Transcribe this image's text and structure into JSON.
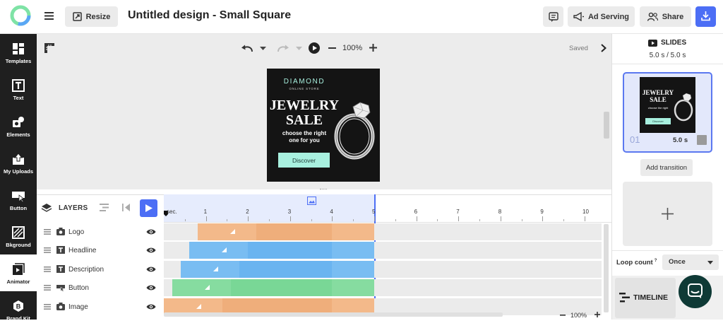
{
  "header": {
    "title": "Untitled design - Small Square",
    "resize_label": "Resize",
    "ad_serving_label": "Ad Serving",
    "share_label": "Share"
  },
  "sidebar": {
    "items": [
      {
        "label": "Templates",
        "icon": "templates-icon"
      },
      {
        "label": "Text",
        "icon": "text-icon"
      },
      {
        "label": "Elements",
        "icon": "elements-icon"
      },
      {
        "label": "My Uploads",
        "icon": "upload-icon"
      },
      {
        "label": "Button",
        "icon": "button-icon"
      },
      {
        "label": "Bkground",
        "icon": "background-icon"
      },
      {
        "label": "Animator",
        "icon": "animator-icon"
      },
      {
        "label": "Brand Kit",
        "icon": "brandkit-icon"
      }
    ]
  },
  "canvas_toolbar": {
    "zoom": "100%",
    "status": "Saved"
  },
  "ad": {
    "brand": "DIAMOND",
    "brand_sub": "ONLINE STORE",
    "headline_1": "JEWELRY",
    "headline_2": "SALE",
    "desc_1": "choose the right",
    "desc_2": "one for you",
    "cta": "Discover"
  },
  "layers": {
    "title": "LAYERS",
    "rows": [
      {
        "name": "Logo",
        "icon": "camera-icon",
        "color": "#f3b98a",
        "color_dark": "#efae7b",
        "start": 0.8
      },
      {
        "name": "Headline",
        "icon": "text-icon",
        "color": "#79bdf2",
        "color_dark": "#6ab4f0",
        "start": 0.6
      },
      {
        "name": "Description",
        "icon": "text-icon",
        "color": "#79bdf2",
        "color_dark": "#6ab4f0",
        "start": 0.4
      },
      {
        "name": "Button",
        "icon": "button-icon",
        "color": "#86dba0",
        "color_dark": "#79d796",
        "start": 0.2
      },
      {
        "name": "Image",
        "icon": "camera-icon",
        "color": "#f3b98a",
        "color_dark": "#efae7b",
        "start": 0.0
      }
    ]
  },
  "timeline": {
    "ruler_first": "sec.",
    "ticks": [
      "1",
      "2",
      "3",
      "4",
      "5",
      "6",
      "7",
      "8",
      "9",
      "10"
    ],
    "end": 5,
    "zoom": "100%"
  },
  "slides": {
    "title": "SLIDES",
    "duration": "5.0 s / 5.0 s",
    "items": [
      {
        "number": "01",
        "duration": "5.0 s"
      }
    ],
    "add_transition": "Add transition"
  },
  "loop": {
    "label": "Loop count",
    "sup": "?",
    "value": "Once"
  },
  "timeline_button": "TIMELINE",
  "colors": {
    "accent": "#4c6ef5",
    "sidebar_bg": "#1f1f1f",
    "cta_bg": "#a8f0df"
  }
}
